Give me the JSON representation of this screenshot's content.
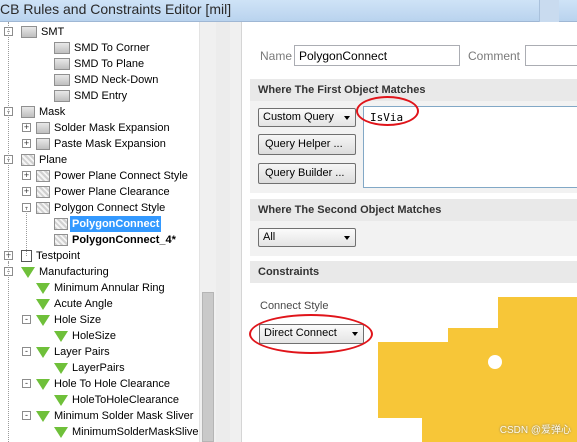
{
  "window": {
    "title": "CB Rules and Constraints Editor [mil]"
  },
  "tree": {
    "items": [
      {
        "label": "SMT",
        "icon": "smt-icon"
      },
      {
        "label": "SMD To Corner",
        "icon": "smt-rule-icon"
      },
      {
        "label": "SMD To Plane",
        "icon": "smt-rule-icon"
      },
      {
        "label": "SMD Neck-Down",
        "icon": "smt-rule-icon"
      },
      {
        "label": "SMD Entry",
        "icon": "smt-rule-icon"
      },
      {
        "label": "Mask",
        "icon": "mask-icon"
      },
      {
        "label": "Solder Mask Expansion",
        "icon": "mask-rule-icon"
      },
      {
        "label": "Paste Mask Expansion",
        "icon": "mask-rule-icon"
      },
      {
        "label": "Plane",
        "icon": "plane-icon"
      },
      {
        "label": "Power Plane Connect Style",
        "icon": "plane-rule-icon"
      },
      {
        "label": "Power Plane Clearance",
        "icon": "plane-rule-icon"
      },
      {
        "label": "Polygon Connect Style",
        "icon": "plane-rule-icon"
      },
      {
        "label": "PolygonConnect",
        "icon": "plane-rule-icon"
      },
      {
        "label": "PolygonConnect_4*",
        "icon": "plane-rule-icon"
      },
      {
        "label": "Testpoint",
        "icon": "testpoint-icon"
      },
      {
        "label": "Manufacturing",
        "icon": "manufacturing-icon"
      },
      {
        "label": "Minimum Annular Ring",
        "icon": "funnel-icon"
      },
      {
        "label": "Acute Angle",
        "icon": "funnel-icon"
      },
      {
        "label": "Hole Size",
        "icon": "funnel-icon"
      },
      {
        "label": "HoleSize",
        "icon": "funnel-icon"
      },
      {
        "label": "Layer Pairs",
        "icon": "funnel-icon"
      },
      {
        "label": "LayerPairs",
        "icon": "funnel-icon"
      },
      {
        "label": "Hole To Hole Clearance",
        "icon": "funnel-icon"
      },
      {
        "label": "HoleToHoleClearance",
        "icon": "funnel-icon"
      },
      {
        "label": "Minimum Solder Mask Sliver",
        "icon": "funnel-icon"
      },
      {
        "label": "MinimumSolderMaskSliver",
        "icon": "funnel-icon"
      }
    ]
  },
  "rule": {
    "name_label": "Name",
    "name_value": "PolygonConnect",
    "comment_label": "Comment"
  },
  "first_object": {
    "header": "Where The First Object Matches",
    "query_type": "Custom Query",
    "query_helper": "Query Helper ...",
    "query_builder": "Query Builder ...",
    "query_text": "IsVia"
  },
  "second_object": {
    "header": "Where The Second Object Matches",
    "selected": "All"
  },
  "constraints": {
    "header": "Constraints",
    "connect_style_label": "Connect Style",
    "connect_style_value": "Direct Connect"
  },
  "watermark": "CSDN @爱弹心",
  "colors": {
    "selection": "#3399ff",
    "annotation": "#e0141a",
    "copper": "#f7c638"
  }
}
